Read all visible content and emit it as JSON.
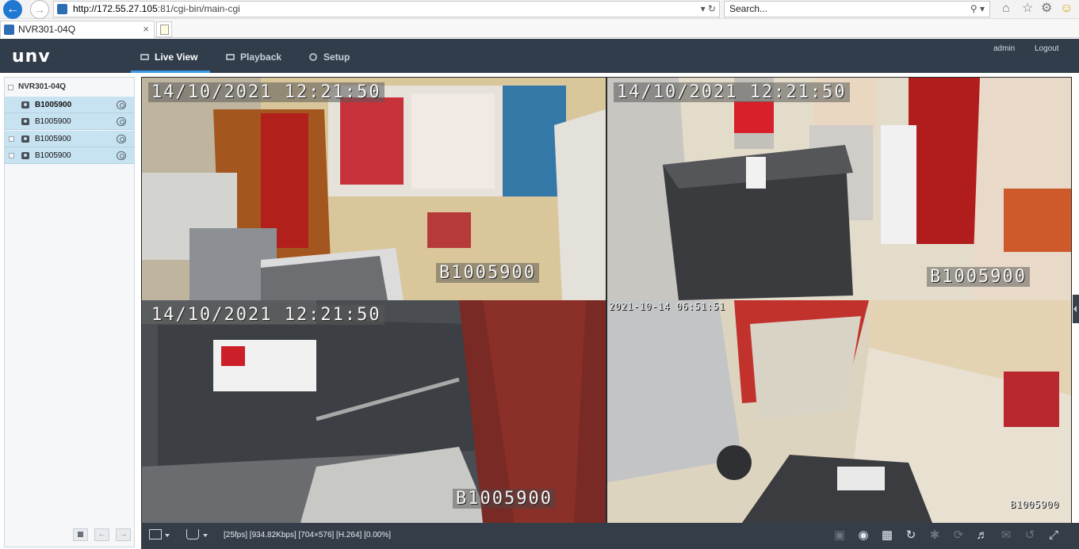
{
  "browser": {
    "url_host": "http://172.55.27.105",
    "url_rest": ":81/cgi-bin/main-cgi",
    "search_placeholder": "Search...",
    "tab_title": "NVR301-04Q",
    "tab_close": "×"
  },
  "header": {
    "logo": "unv",
    "nav": [
      "Live View",
      "Playback",
      "Setup"
    ],
    "user": "admin",
    "logout": "Logout"
  },
  "sidebar": {
    "device": "NVR301-04Q",
    "cameras": [
      "B1005900",
      "B1005900",
      "B1005900",
      "B1005900"
    ]
  },
  "video": {
    "panes": [
      {
        "timestamp": "14/10/2021  12:21:50",
        "camera_label": "B1005900"
      },
      {
        "timestamp": "14/10/2021  12:21:50",
        "camera_label": "B1005900"
      },
      {
        "timestamp": "14/10/2021  12:21:50",
        "camera_label": "B1005900"
      },
      {
        "timestamp": "2021-10-14 06:51:51",
        "camera_label": "B1005900"
      }
    ]
  },
  "toolbar": {
    "stream_info": "[25fps] [934.82Kbps] [704×576] [H.264] [0.00%]"
  },
  "colors": {
    "header_bg": "#313d4a",
    "accent": "#3c9be8",
    "camera_row_bg": "#c7e2f1",
    "toolbar_bg": "#353e48"
  }
}
